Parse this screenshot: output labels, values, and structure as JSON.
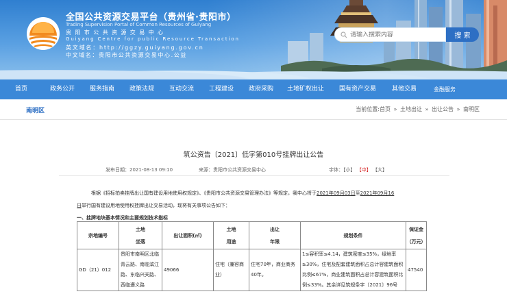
{
  "header": {
    "title_cn": "全国公共资源交易平台（贵州省·贵阳市）",
    "title_en": "Trading Supervision Portal of Common Resources of Guiyang",
    "subtitle_cn": "贵阳市公共资源交易中心",
    "subtitle_en": "Guiyang Centre for public Resource Transaction",
    "domain_en": "英文域名：http://ggzy.guiyang.gov.cn",
    "domain_cn": "中文域名：贵阳市公共资源交易中心.公益",
    "search_placeholder": "请输入搜索内容",
    "search_button": "搜 索"
  },
  "nav": {
    "items": [
      "首页",
      "政务公开",
      "服务指南",
      "政策法规",
      "互动交流",
      "工程建设",
      "政府采购",
      "土地矿权出让",
      "国有资产交易",
      "其他交易",
      "金融服务"
    ]
  },
  "breadcrumb": {
    "district": "南明区",
    "prefix": "当前位置:",
    "items": [
      "首页",
      "土地出让",
      "出让公告",
      "南明区"
    ],
    "separator": "»"
  },
  "article": {
    "title": "筑公资告〔2021〕低字第010号挂牌出让公告",
    "publish_date": "发布日期：2021-08-13 09:10",
    "source": "来源：贵阳市公共资源交易中心",
    "font_label": "字体：",
    "font_small": "【小】",
    "font_mid": "【中】",
    "font_large": "【大】",
    "para1_a": "根据《招标拍卖挂牌出让国有建设用地使用权规定》、《贵阳市公共资源交易管理办法》等规定，我中心将于",
    "para1_date1": "2021年09月03日",
    "para1_to": "至",
    "para1_date2": "2021年09月16",
    "para2_date": "日",
    "para2_rest": "举行国有建设用地使用权挂牌出让交易活动，现将有关事项公告如下：",
    "section1": "一、挂牌地块基本情况和主要规划技术指标"
  },
  "table": {
    "headers": {
      "parcel": "宗地编号",
      "location": [
        "土地",
        "坐落"
      ],
      "area": "出让面积(㎡)",
      "use": [
        "土地",
        "用途"
      ],
      "term": [
        "出让",
        "年限"
      ],
      "planning": "规划条件",
      "deposit": [
        "保证金",
        "（万元）"
      ]
    },
    "rows": [
      {
        "parcel": "GD（21）012",
        "location": "贵阳市南明区北临青云路、南临滨江路、东临兴关路、西临遵义路",
        "area": "49066",
        "use": "住宅（兼容商业）",
        "term": "住宅70年，商业商务40年。",
        "planning": "1≤容积率≤4.14，建筑密度≤35%，绿地率≥30%，住宅及配套建筑面积占总计容建筑面积比例≤67%，商业建筑面积占总计容建筑面积比例≤33%。其余详见筑规条字〔2021〕96号",
        "deposit": "47540"
      }
    ]
  },
  "colors": {
    "nav_bg": "#3b88d8",
    "accent": "#2d6fc4",
    "font_mid_red": "#d62a2a"
  }
}
